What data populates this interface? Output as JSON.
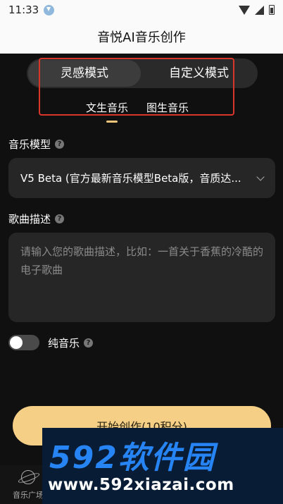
{
  "status_bar": {
    "time": "11:33"
  },
  "header": {
    "title": "音悦AI音乐创作"
  },
  "mode_tabs": {
    "inspiration": "灵感模式",
    "custom": "自定义模式"
  },
  "sub_tabs": {
    "text_music": "文生音乐",
    "image_music": "图生音乐"
  },
  "model": {
    "label": "音乐模型",
    "value": "V5 Beta (官方最新音乐模型Beta版，音质达..."
  },
  "description": {
    "label": "歌曲描述",
    "placeholder": "请输入您的歌曲描述，比如：一首关于香蕉的冷酷的电子歌曲"
  },
  "instrumental": {
    "label": "纯音乐",
    "enabled": false
  },
  "create_button": {
    "label": "开始创作(10积分)"
  },
  "bottom_nav": {
    "plaza": "音乐广场"
  },
  "watermark": {
    "logo": "592软件园",
    "url": "www.592xiazai.com"
  },
  "colors": {
    "accent": "#f6cf86",
    "highlight_box": "#d9362b",
    "watermark_blue": "#2684f4"
  }
}
